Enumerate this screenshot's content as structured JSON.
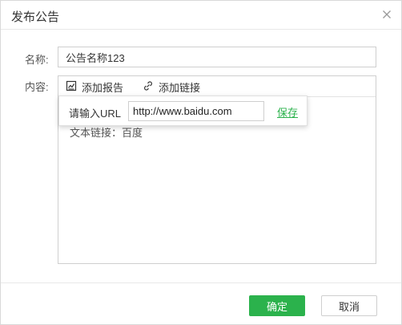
{
  "dialog": {
    "title": "发布公告",
    "close_icon": "close-icon"
  },
  "form": {
    "name_label": "名称:",
    "name_value": "公告名称123",
    "content_label": "内容:"
  },
  "toolbar": {
    "add_report_label": "添加报告",
    "add_report_icon": "chart-box-icon",
    "add_link_label": "添加链接",
    "add_link_icon": "link-icon"
  },
  "editor": {
    "text": "文本链接：百度"
  },
  "url_popup": {
    "label": "请输入URL",
    "value": "http://www.baidu.com",
    "save_label": "保存"
  },
  "footer": {
    "ok_label": "确定",
    "cancel_label": "取消"
  },
  "colors": {
    "accent": "#2bb24c",
    "border": "#cfcfcf"
  }
}
